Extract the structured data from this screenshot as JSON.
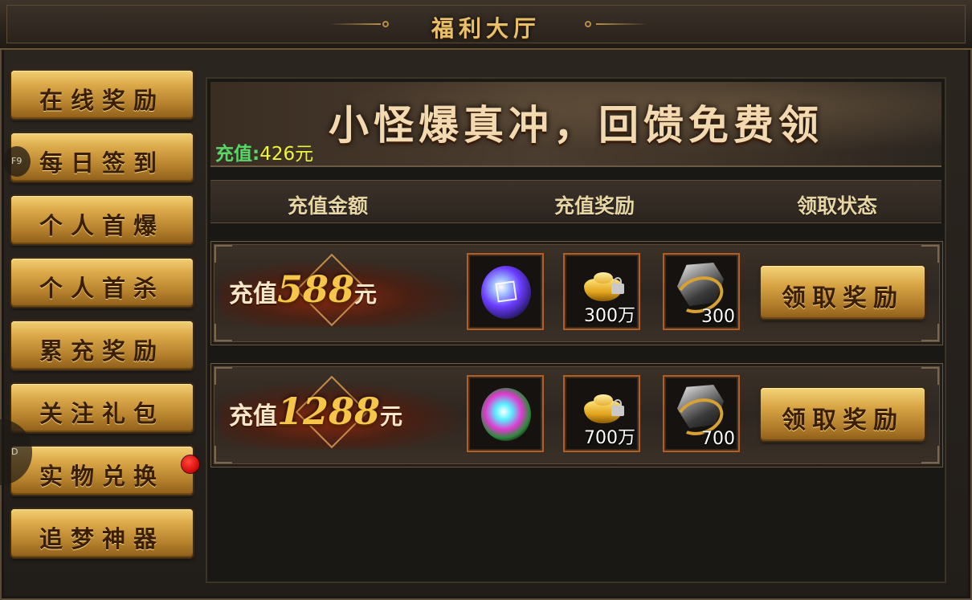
{
  "window": {
    "title": "福利大厅"
  },
  "sidebar": {
    "items": [
      {
        "label": "在线奖励"
      },
      {
        "label": "每日签到"
      },
      {
        "label": "个人首爆"
      },
      {
        "label": "个人首杀"
      },
      {
        "label": "累充奖励"
      },
      {
        "label": "关注礼包"
      },
      {
        "label": "实物兑换"
      },
      {
        "label": "追梦神器"
      }
    ],
    "hotkeys": {
      "f9": "F9",
      "d": "D"
    }
  },
  "banner": {
    "slogan": "小怪爆真冲，回馈免费领",
    "recharge_label": "充值:",
    "recharge_value": "426元"
  },
  "table": {
    "headers": [
      "充值金额",
      "充值奖励",
      "领取状态"
    ],
    "rows": [
      {
        "prefix": "充值",
        "amount": "588",
        "suffix": "元",
        "rewards": [
          {
            "icon": "purple-orb-icon",
            "count": ""
          },
          {
            "icon": "gold-ingot-icon",
            "count": "300万"
          },
          {
            "icon": "stone-ring-icon",
            "count": "300"
          }
        ],
        "button": "领取奖励"
      },
      {
        "prefix": "充值",
        "amount": "1288",
        "suffix": "元",
        "rewards": [
          {
            "icon": "rainbow-orb-icon",
            "count": ""
          },
          {
            "icon": "gold-ingot-icon",
            "count": "700万"
          },
          {
            "icon": "stone-ring-icon",
            "count": "700"
          }
        ],
        "button": "领取奖励"
      }
    ]
  },
  "colors": {
    "accent_gold": "#e9c06a",
    "recharge_label": "#56d86a",
    "recharge_value": "#eef53c",
    "notification": "#d80f0f"
  }
}
